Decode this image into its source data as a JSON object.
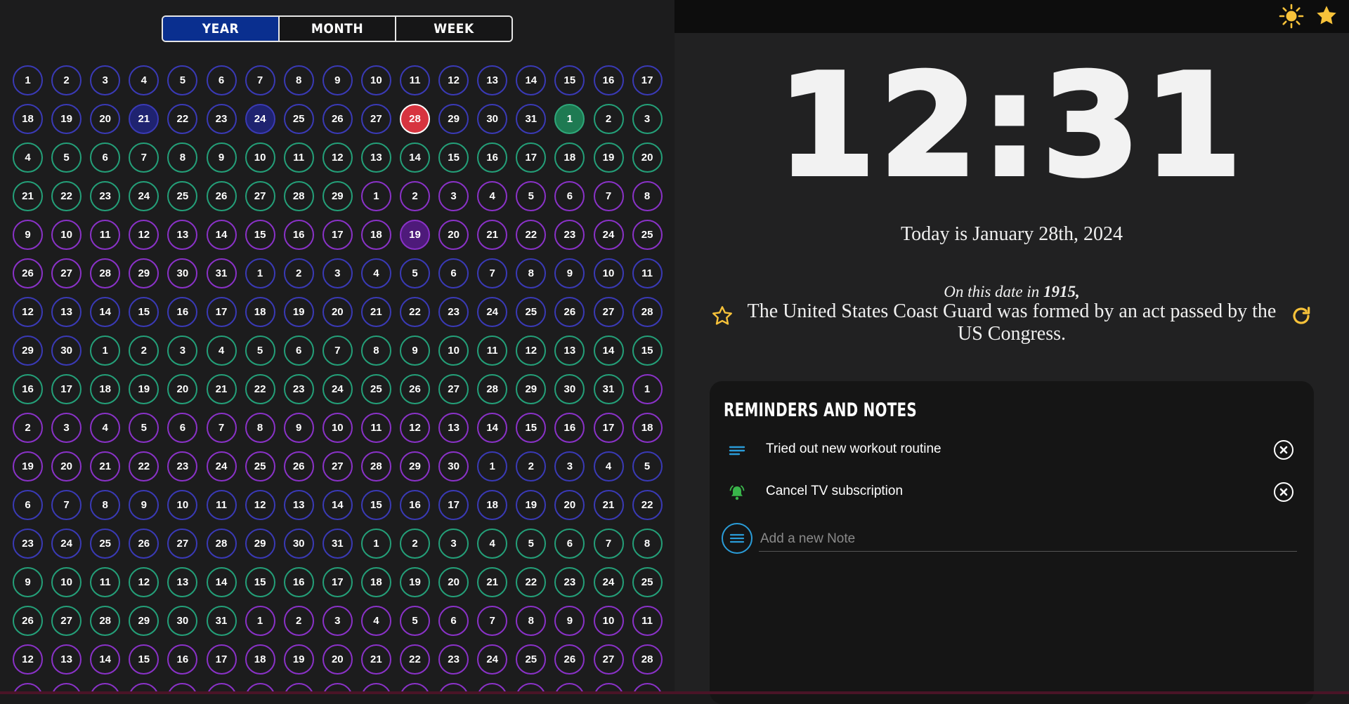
{
  "view_toggle": {
    "options": [
      "YEAR",
      "MONTH",
      "WEEK"
    ],
    "selected": "YEAR"
  },
  "calendar": {
    "rows": [
      [
        "1",
        "2",
        "3",
        "4",
        "5",
        "6",
        "7",
        "8",
        "9",
        "10",
        "11",
        "12",
        "13",
        "14",
        "15",
        "16",
        "17"
      ],
      [
        "18",
        "19",
        "20",
        "21",
        "22",
        "23",
        "24",
        "25",
        "26",
        "27",
        "28",
        "29",
        "30",
        "31",
        "1",
        "2",
        "3"
      ],
      [
        "4",
        "5",
        "6",
        "7",
        "8",
        "9",
        "10",
        "11",
        "12",
        "13",
        "14",
        "15",
        "16",
        "17",
        "18",
        "19",
        "20"
      ],
      [
        "21",
        "22",
        "23",
        "24",
        "25",
        "26",
        "27",
        "28",
        "29",
        "1",
        "2",
        "3",
        "4",
        "5",
        "6",
        "7",
        "8"
      ],
      [
        "9",
        "10",
        "11",
        "12",
        "13",
        "14",
        "15",
        "16",
        "17",
        "18",
        "19",
        "20",
        "21",
        "22",
        "23",
        "24",
        "25"
      ],
      [
        "26",
        "27",
        "28",
        "29",
        "30",
        "31",
        "1",
        "2",
        "3",
        "4",
        "5",
        "6",
        "7",
        "8",
        "9",
        "10",
        "11"
      ],
      [
        "12",
        "13",
        "14",
        "15",
        "16",
        "17",
        "18",
        "19",
        "20",
        "21",
        "22",
        "23",
        "24",
        "25",
        "26",
        "27",
        "28"
      ],
      [
        "29",
        "30",
        "1",
        "2",
        "3",
        "4",
        "5",
        "6",
        "7",
        "8",
        "9",
        "10",
        "11",
        "12",
        "13",
        "14",
        "15"
      ],
      [
        "16",
        "17",
        "18",
        "19",
        "20",
        "21",
        "22",
        "23",
        "24",
        "25",
        "26",
        "27",
        "28",
        "29",
        "30",
        "31",
        "1"
      ],
      [
        "2",
        "3",
        "4",
        "5",
        "6",
        "7",
        "8",
        "9",
        "10",
        "11",
        "12",
        "13",
        "14",
        "15",
        "16",
        "17",
        "18"
      ],
      [
        "19",
        "20",
        "21",
        "22",
        "23",
        "24",
        "25",
        "26",
        "27",
        "28",
        "29",
        "30",
        "1",
        "2",
        "3",
        "4",
        "5"
      ],
      [
        "6",
        "7",
        "8",
        "9",
        "10",
        "11",
        "12",
        "13",
        "14",
        "15",
        "16",
        "17",
        "18",
        "19",
        "20",
        "21",
        "22"
      ],
      [
        "23",
        "24",
        "25",
        "26",
        "27",
        "28",
        "29",
        "30",
        "31",
        "1",
        "2",
        "3",
        "4",
        "5",
        "6",
        "7",
        "8"
      ],
      [
        "9",
        "10",
        "11",
        "12",
        "13",
        "14",
        "15",
        "16",
        "17",
        "18",
        "19",
        "20",
        "21",
        "22",
        "23",
        "24",
        "25"
      ],
      [
        "26",
        "27",
        "28",
        "29",
        "30",
        "31",
        "1",
        "2",
        "3",
        "4",
        "5",
        "6",
        "7",
        "8",
        "9",
        "10",
        "11"
      ],
      [
        "12",
        "13",
        "14",
        "15",
        "16",
        "17",
        "18",
        "19",
        "20",
        "21",
        "22",
        "23",
        "24",
        "25",
        "26",
        "27",
        "28"
      ]
    ],
    "ring_colors": {
      "blue": "#3a3ab6",
      "green": "#24a079",
      "purple": "#8a32c8",
      "today": "#d7343f"
    }
  },
  "clock": {
    "time": "12:31"
  },
  "today_label": "Today is January 28th, 2024",
  "history": {
    "intro_prefix": "On this date in ",
    "year": "1915",
    "intro_suffix": ",",
    "fact": "The United States Coast Guard was formed by an act passed by the US Congress."
  },
  "notes": {
    "title": "REMINDERS AND NOTES",
    "items": [
      {
        "text": "Tried out new workout routine",
        "icon": "note-lines-icon"
      },
      {
        "text": "Cancel TV subscription",
        "icon": "bell-alert-icon"
      }
    ],
    "add_placeholder": "Add a new Note"
  },
  "colors": {
    "accent_yellow": "#f7c23a",
    "year_button_active": "#0a2f8f",
    "note_icon_blue": "#2a9cd8",
    "bell_green": "#39b54a"
  }
}
